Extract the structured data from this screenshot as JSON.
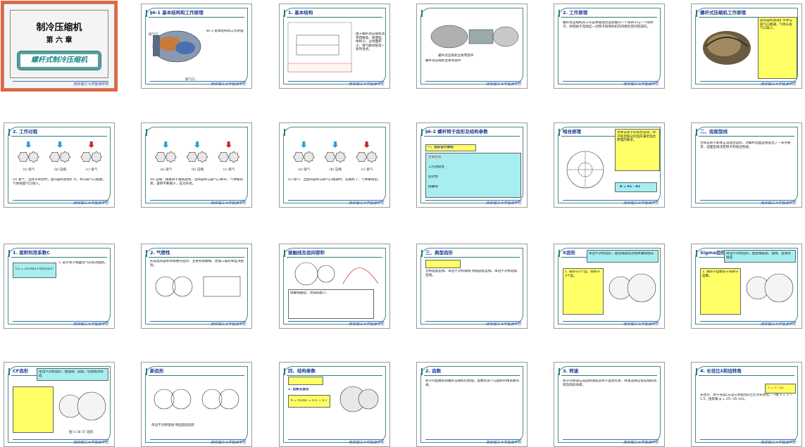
{
  "footer_text": "西安理工大学能源学院",
  "slides": [
    {
      "id": "s1",
      "title_main": "制冷压缩机",
      "chapter": "第 六 章",
      "subtitle": "螺杆式制冷压缩机",
      "selected": true
    },
    {
      "id": "s2",
      "title": "§6-1 基本结构和工作原理",
      "inlet": "吸气口",
      "outlet": "排气口"
    },
    {
      "id": "s3",
      "title": "1. 基本结构",
      "text": "由于螺杆式压缩机具有转数高、质量轻、体积小、占地面积小、排气脉动低等一系列优点。"
    },
    {
      "id": "s4",
      "title": "",
      "caption": "螺杆式压缩机主要零部件"
    },
    {
      "id": "s5",
      "title": "2. 工作原理",
      "text": "螺杆式压缩机的工作是依靠啮合运动着的一个阳转子与一个阴转子，并借助于包围这一对转子四周的机壳内壁的空间完成的。"
    },
    {
      "id": "s6",
      "title": "螺杆式压缩机工作原理",
      "text": "齿间容积逐渐扩大并与吸气口相通，气体从吸气口吸入。"
    },
    {
      "id": "s7",
      "title": "2. 工作过程",
      "labels": [
        "(a) 吸气",
        "(b) 压缩",
        "(c) 排气"
      ],
      "text": "(a) 吸气：当转子转动时，齿间容积逐渐扩大，并与吸气口相通，气体经吸气口进入。"
    },
    {
      "id": "s8",
      "title": "",
      "labels": [
        "(a) 吸气",
        "(b) 压缩",
        "(c) 排气"
      ],
      "text": "(b) 压缩：随着转子继续旋转，齿间容积与吸气口断开，气体被封闭，容积不断缩小，压力升高。"
    },
    {
      "id": "s9",
      "title": "",
      "labels": [
        "(a) 吸气",
        "(b) 压缩",
        "(c) 排气"
      ],
      "text": "(c) 排气：当齿间容积与排气口相通时，压缩终了，气体被排出。"
    },
    {
      "id": "s10",
      "title": "§6-2 螺杆转子齿形及结构参数",
      "sub": "一、齿形设计原则",
      "rows": [
        "主要原则",
        "工作连续性",
        "密封性",
        "接触线"
      ]
    },
    {
      "id": "s11",
      "title": "啮合原理",
      "formula": "B = R1 - R2",
      "text": "为保证转子的啮合运动，转子啮合部分的齿形满足啮合原理的要求。"
    },
    {
      "id": "s12",
      "title": "二、齿面型线",
      "text": "为保证转子能够正常啮合运转，对螺杆齿面型线提出了一系列要求，齿面型线决定转子的啮合性能。"
    },
    {
      "id": "s13",
      "title": "1. 面积利用系数C",
      "text": "C 表示转子端面空气的有效面积。",
      "formula": "Cn = Z1(A01+A02)/D1²"
    },
    {
      "id": "s14",
      "title": "2. 气密性",
      "text": "形成齿间容积所需要的密封，主要有接触线、泄漏三角形和齿顶密封。"
    },
    {
      "id": "s15",
      "title": "接触线及齿间容积",
      "text": "接触线越短，泄漏就越少。"
    },
    {
      "id": "s16",
      "title": "三、典型齿形",
      "text": "对称圆弧型线、单边不对称摆线-销齿圆弧型线、单边不对称圆弧型线。"
    },
    {
      "id": "s17",
      "title": "X齿形",
      "head": "单边不对称齿形，由齿根圆弧及相关曲线组成",
      "text": "1. 阳转子2个齿，阴转子3个齿。"
    },
    {
      "id": "s18",
      "title": "Sigma齿形",
      "head": "单边不对称齿形，由齿根圆弧、摆线、直线等组成",
      "text": "1. 阴转子齿数多于阳转子齿数。"
    },
    {
      "id": "s19",
      "title": "CF齿形",
      "head": "单边不对称齿形，由摆线、圆弧、包络线等组成",
      "caption": "图 5-18  CF 齿形"
    },
    {
      "id": "s20",
      "title": "新齿形",
      "caption": "单边不对称摆线-销齿圆弧齿形"
    },
    {
      "id": "s21",
      "title": "四、结构参数",
      "sub": "1. 齿数及直径",
      "formula": "δ = R1/R2 = 0.5 ~ 0.7"
    },
    {
      "id": "s22",
      "title": "2. 齿数",
      "text": "转子的齿数影响螺杆压缩机的性能。齿数的多少与面积利用系数有关。"
    },
    {
      "id": "s23",
      "title": "3. 转速",
      "text": "转子的转速与其圆周速度及转子直径有关，转速选择应使压缩机具有较高的效率。"
    },
    {
      "id": "s24",
      "title": "4. 长径比λ和扭转角",
      "text": "长径比：转子长度L与其公称直径D之比为长径比，一般 λ = 1 ~ 1.5，扭转角 φ = 25~35 m/s。",
      "formula": "λ = L / D1"
    }
  ]
}
